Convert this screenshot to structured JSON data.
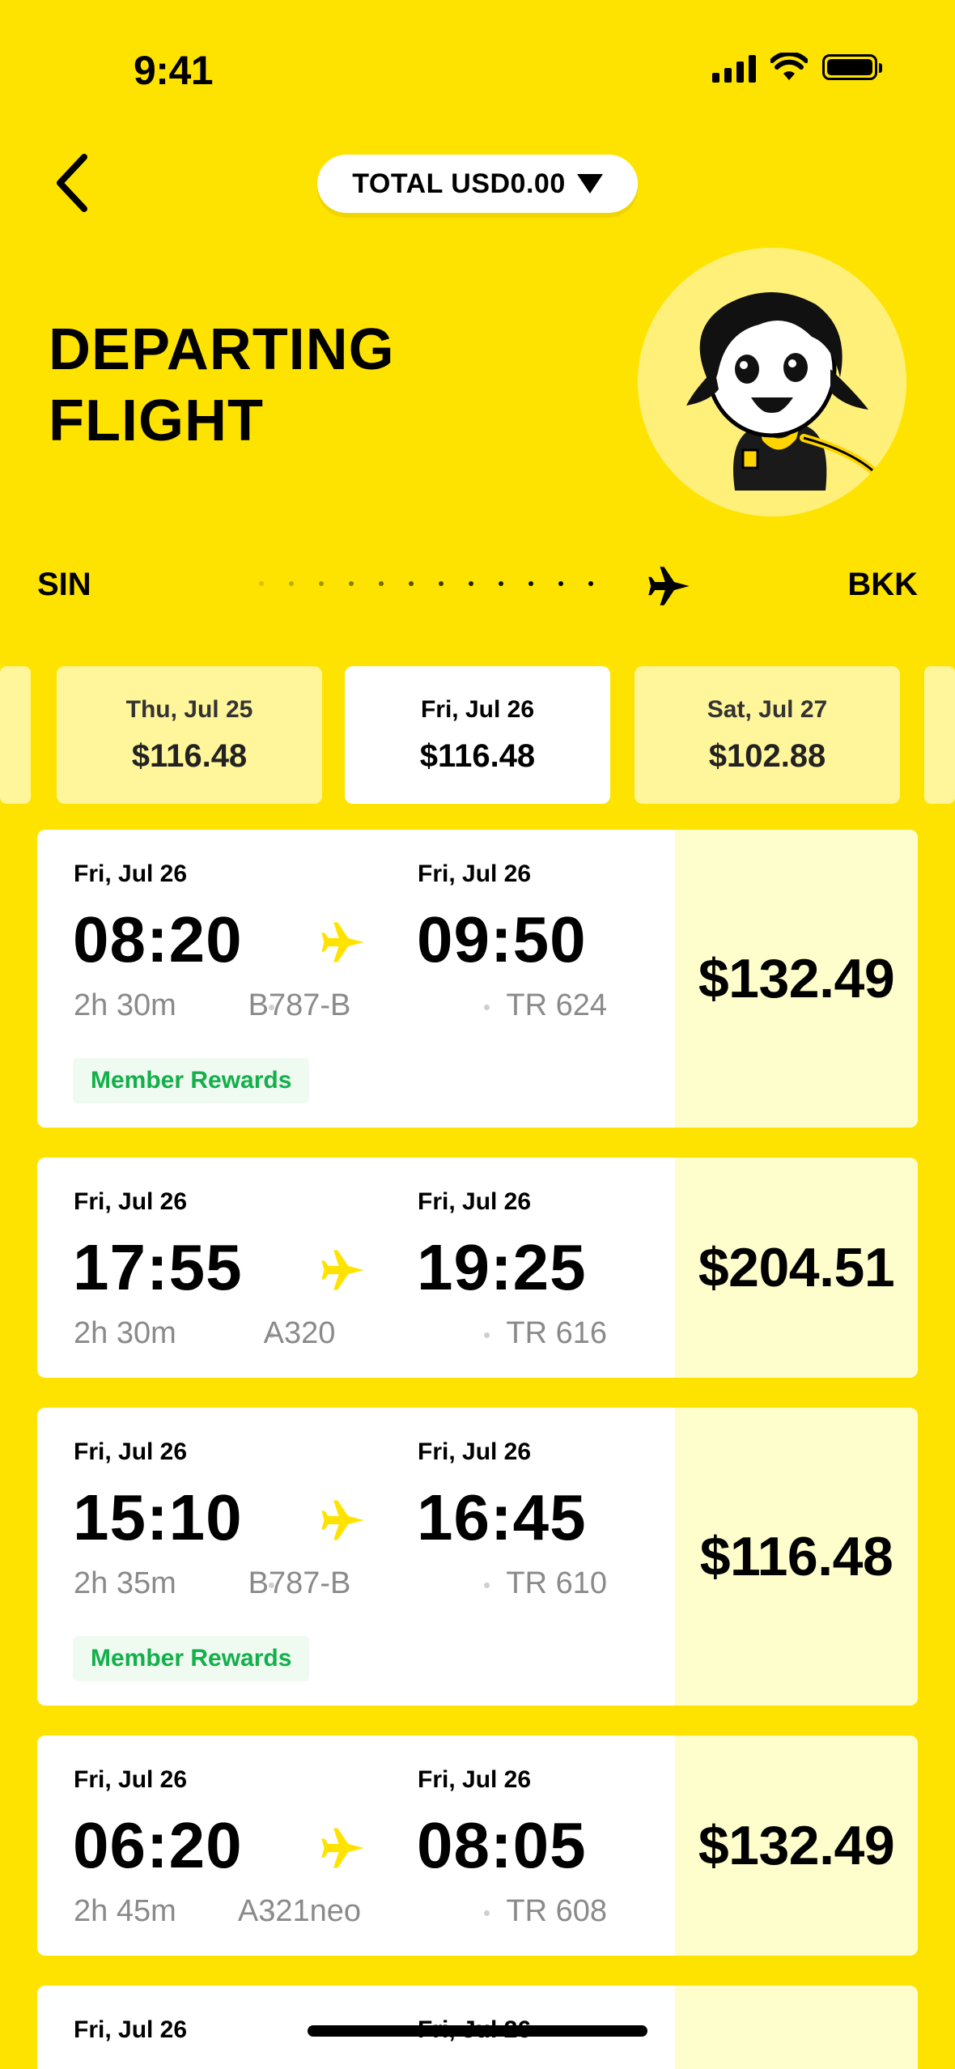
{
  "status": {
    "time": "9:41"
  },
  "header": {
    "total_label": "TOTAL USD0.00"
  },
  "page": {
    "title_line1": "DEPARTING",
    "title_line2": "FLIGHT"
  },
  "route": {
    "from": "SIN",
    "to": "BKK"
  },
  "dates": [
    {
      "label": "Thu, Jul 25",
      "price": "$116.48"
    },
    {
      "label": "Fri, Jul 26",
      "price": "$116.48",
      "active": true
    },
    {
      "label": "Sat, Jul 27",
      "price": "$102.88"
    }
  ],
  "flights": [
    {
      "depart_date": "Fri, Jul 26",
      "arrive_date": "Fri, Jul 26",
      "depart_time": "08:20",
      "arrive_time": "09:50",
      "duration": "2h 30m",
      "aircraft": "B787-B",
      "flight_no": "TR 624",
      "price": "$132.49",
      "badge": "Member Rewards"
    },
    {
      "depart_date": "Fri, Jul 26",
      "arrive_date": "Fri, Jul 26",
      "depart_time": "17:55",
      "arrive_time": "19:25",
      "duration": "2h 30m",
      "aircraft": "A320",
      "flight_no": "TR 616",
      "price": "$204.51"
    },
    {
      "depart_date": "Fri, Jul 26",
      "arrive_date": "Fri, Jul 26",
      "depart_time": "15:10",
      "arrive_time": "16:45",
      "duration": "2h 35m",
      "aircraft": "B787-B",
      "flight_no": "TR 610",
      "price": "$116.48",
      "badge": "Member Rewards"
    },
    {
      "depart_date": "Fri, Jul 26",
      "arrive_date": "Fri, Jul 26",
      "depart_time": "06:20",
      "arrive_time": "08:05",
      "duration": "2h 45m",
      "aircraft": "A321neo",
      "flight_no": "TR 608",
      "price": "$132.49"
    },
    {
      "depart_date": "Fri, Jul 26",
      "arrive_date": "Fri, Jul 26"
    }
  ],
  "colors": {
    "brand_yellow": "#FFE300",
    "price_bg": "#FEFDCC",
    "reward_green": "#12B04A",
    "tab_inactive": "#FFF59A"
  },
  "icons": {
    "back": "chevron-left-icon",
    "dropdown": "caret-down-icon",
    "plane": "airplane-icon"
  }
}
